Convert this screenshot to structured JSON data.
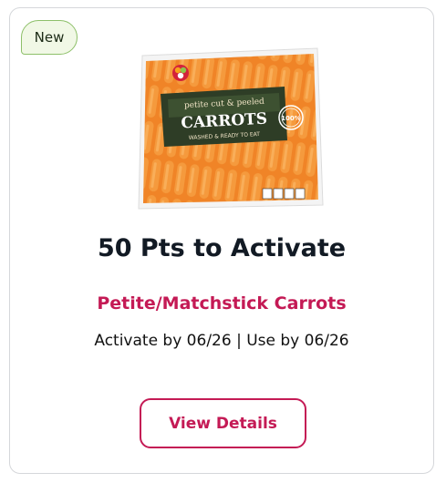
{
  "badge": {
    "label": "New"
  },
  "offer": {
    "title": "50 Pts to Activate",
    "product_name": "Petite/Matchstick Carrots",
    "dates": "Activate by 06/26 | Use by 06/26"
  },
  "product_image": {
    "label_top": "petite cut & peeled",
    "label_main": "CARROTS",
    "label_sub": "WASHED & READY TO EAT",
    "seal_text": "100%"
  },
  "button": {
    "label": "View Details"
  },
  "colors": {
    "accent": "#c41a55",
    "badge_border": "#8ec06a",
    "badge_bg": "#f1f8e6",
    "carrot": "#ef7f22",
    "package_label": "#2e3d26"
  }
}
